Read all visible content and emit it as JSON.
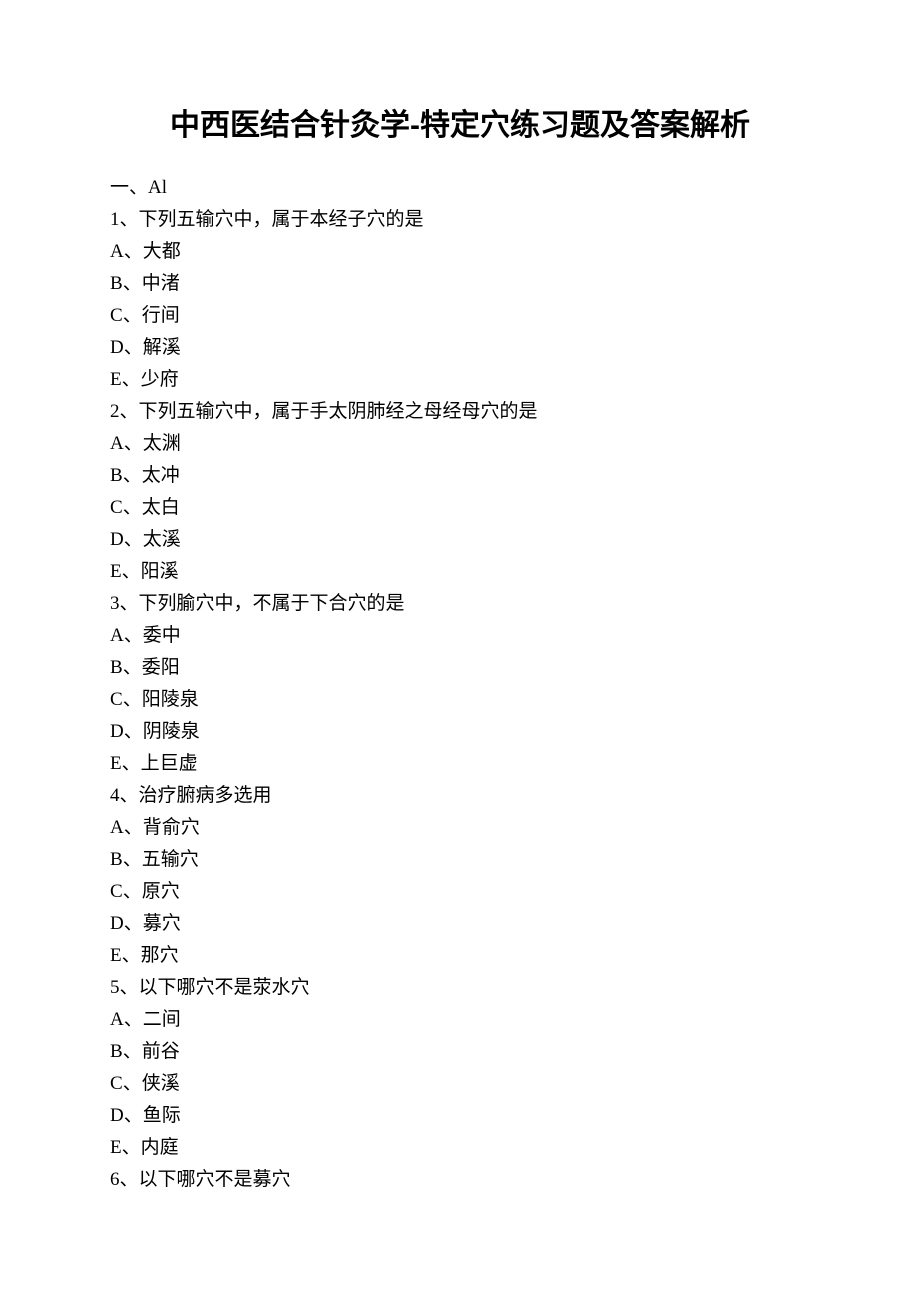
{
  "title": "中西医结合针灸学-特定穴练习题及答案解析",
  "section": "一、Al",
  "questions": [
    {
      "num": "1",
      "stem": "下列五输穴中，属于本经子穴的是",
      "options": [
        {
          "letter": "A",
          "text": "大都"
        },
        {
          "letter": "B",
          "text": "中渚"
        },
        {
          "letter": "C",
          "text": "行间"
        },
        {
          "letter": "D",
          "text": "解溪"
        },
        {
          "letter": "E",
          "text": "少府"
        }
      ]
    },
    {
      "num": "2",
      "stem": "下列五输穴中，属于手太阴肺经之母经母穴的是",
      "options": [
        {
          "letter": "A",
          "text": "太渊"
        },
        {
          "letter": "B",
          "text": "太冲"
        },
        {
          "letter": "C",
          "text": "太白"
        },
        {
          "letter": "D",
          "text": "太溪"
        },
        {
          "letter": "E",
          "text": "阳溪"
        }
      ]
    },
    {
      "num": "3",
      "stem": "下列腧穴中，不属于下合穴的是",
      "options": [
        {
          "letter": "A",
          "text": "委中"
        },
        {
          "letter": "B",
          "text": "委阳"
        },
        {
          "letter": "C",
          "text": "阳陵泉"
        },
        {
          "letter": "D",
          "text": "阴陵泉"
        },
        {
          "letter": "E",
          "text": "上巨虚"
        }
      ]
    },
    {
      "num": "4",
      "stem": "治疗腑病多选用",
      "options": [
        {
          "letter": "A",
          "text": "背俞穴"
        },
        {
          "letter": "B",
          "text": "五输穴"
        },
        {
          "letter": "C",
          "text": "原穴"
        },
        {
          "letter": "D",
          "text": "募穴"
        },
        {
          "letter": "E",
          "text": "那穴"
        }
      ]
    },
    {
      "num": "5",
      "stem": "以下哪穴不是荥水穴",
      "options": [
        {
          "letter": "A",
          "text": "二间"
        },
        {
          "letter": "B",
          "text": "前谷"
        },
        {
          "letter": "C",
          "text": "侠溪"
        },
        {
          "letter": "D",
          "text": "鱼际"
        },
        {
          "letter": "E",
          "text": "内庭"
        }
      ]
    },
    {
      "num": "6",
      "stem": "以下哪穴不是募穴",
      "options": []
    }
  ]
}
